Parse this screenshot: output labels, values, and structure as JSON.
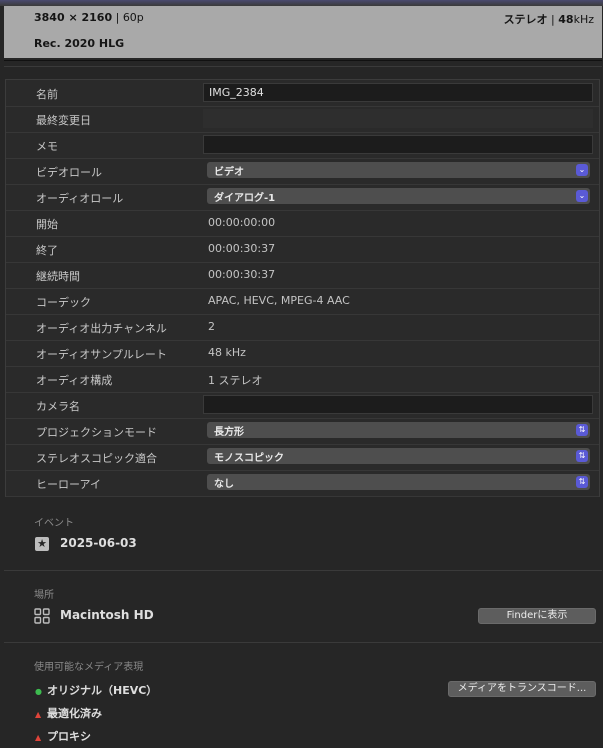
{
  "header": {
    "resolution": "3840 × 2160",
    "frame_rate": "60p",
    "audio_channels": "ステレオ",
    "sample_rate_num": "48",
    "sample_rate_unit": "kHz",
    "color_space": "Rec. 2020 HLG"
  },
  "properties": [
    {
      "label": "名前",
      "kind": "field",
      "value": "IMG_2384"
    },
    {
      "label": "最終変更日",
      "kind": "field-dim",
      "value": ""
    },
    {
      "label": "メモ",
      "kind": "field",
      "value": ""
    },
    {
      "label": "ビデオロール",
      "kind": "popup",
      "value": "ビデオ",
      "stepper": "⌄"
    },
    {
      "label": "オーディオロール",
      "kind": "popup",
      "value": "ダイアログ-1",
      "stepper": "⌄"
    },
    {
      "label": "開始",
      "kind": "text",
      "value": "00:00:00:00"
    },
    {
      "label": "終了",
      "kind": "text",
      "value": "00:00:30:37"
    },
    {
      "label": "継続時間",
      "kind": "text",
      "value": "00:00:30:37"
    },
    {
      "label": "コーデック",
      "kind": "text",
      "value": "APAC, HEVC, MPEG-4 AAC"
    },
    {
      "label": "オーディオ出力チャンネル",
      "kind": "text",
      "value": "2"
    },
    {
      "label": "オーディオサンプルレート",
      "kind": "text",
      "value": "48 kHz"
    },
    {
      "label": "オーディオ構成",
      "kind": "text",
      "value": "1 ステレオ"
    },
    {
      "label": "カメラ名",
      "kind": "field",
      "value": ""
    },
    {
      "label": "プロジェクションモード",
      "kind": "popup",
      "value": "長方形",
      "stepper": "⇅"
    },
    {
      "label": "ステレオスコピック適合",
      "kind": "popup",
      "value": "モノスコピック",
      "stepper": "⇅"
    },
    {
      "label": "ヒーローアイ",
      "kind": "popup",
      "value": "なし",
      "stepper": "⇅"
    }
  ],
  "event": {
    "section_label": "イベント",
    "icon": "star-icon",
    "date": "2025-06-03"
  },
  "location": {
    "section_label": "場所",
    "icon": "drive-grid-icon",
    "volume": "Macintosh HD",
    "finder_button": "Finderに表示"
  },
  "media": {
    "section_label": "使用可能なメディア表現",
    "transcode_button": "メディアをトランスコード...",
    "items": [
      {
        "label": "オリジナル（HEVC）",
        "status": "available",
        "mark": "●"
      },
      {
        "label": "最適化済み",
        "status": "missing",
        "mark": "▲"
      },
      {
        "label": "プロキシ",
        "status": "missing",
        "mark": "▲"
      }
    ]
  },
  "colors": {
    "accent": "#5a5ad6",
    "available": "#3dbb4f",
    "missing": "#e0443a"
  }
}
